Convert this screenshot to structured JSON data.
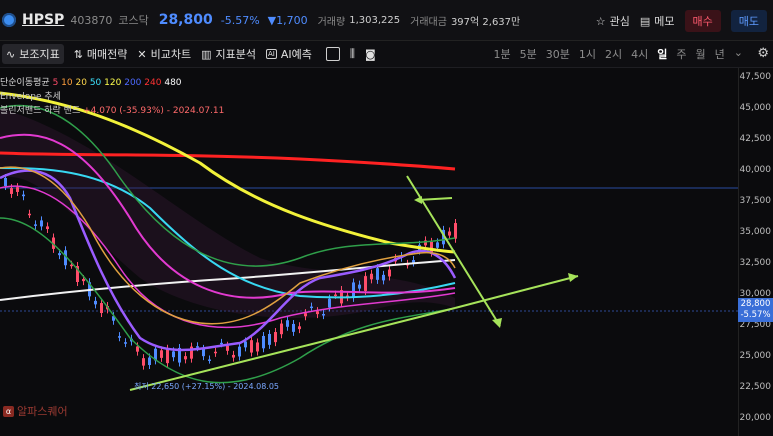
{
  "header": {
    "ticker": "HPSP",
    "code": "403870",
    "market": "코스닥",
    "price": "28,800",
    "change_pct": "-5.57%",
    "change_abs": "▼1,700",
    "volume_label": "거래량",
    "volume_value": "1,303,225",
    "amount_label": "거래대금",
    "amount_value": "397억 2,637만"
  },
  "actions": {
    "watch_label": "관심",
    "memo_label": "메모",
    "buy_label": "매수",
    "sell_label": "매도"
  },
  "toolbar": {
    "items": [
      "보조지표",
      "매매전략",
      "비교차트",
      "지표분석",
      "AI예측"
    ]
  },
  "periods": [
    "1분",
    "5분",
    "30분",
    "1시",
    "2시",
    "4시",
    "일",
    "주",
    "월",
    "년"
  ],
  "legend": {
    "ma_label": "단순이동평균",
    "ma_periods": [
      "5",
      "10",
      "20",
      "50",
      "120",
      "200",
      "240",
      "480"
    ],
    "ma_colors": [
      "#ff4d6a",
      "#ff9e3d",
      "#ffd84d",
      "#3de3ff",
      "#ffff4d",
      "#4d6aff",
      "#ff3333",
      "#ffffff"
    ],
    "envelope_label": "Envelope 추세",
    "bb_label": "볼린저밴드 하락 밴드",
    "bb_value": "+4.070 (-35.93%) - 2024.07.11"
  },
  "yaxis": {
    "ticks": [
      "47,500",
      "45,000",
      "42,500",
      "40,000",
      "37,500",
      "35,000",
      "32,500",
      "30,000",
      "27,500",
      "25,000",
      "22,500",
      "20,000"
    ],
    "current_price": "28,800",
    "current_pct": "-5.57%"
  },
  "low_annotation": "최저 22,650 (+27.15%) - 2024.08.05",
  "watermark": "알파스퀘어",
  "colors": {
    "accent_blue": "#4f8cff",
    "down": "#4f8cff",
    "up": "#ff4d6a"
  }
}
